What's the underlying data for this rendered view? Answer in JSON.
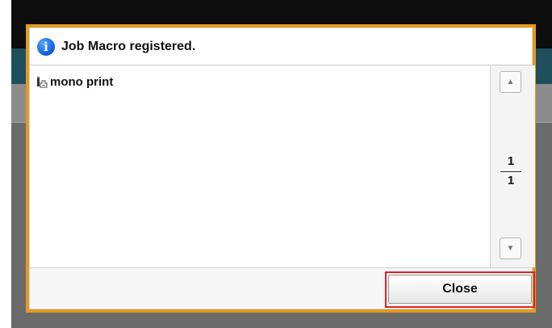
{
  "dialog": {
    "title": "Job Macro registered.",
    "title_icon": "info-icon",
    "items": [
      {
        "label": "mono print",
        "icon": "job-macro-icon"
      }
    ],
    "pager": {
      "current": "1",
      "total": "1"
    },
    "close_label": "Close"
  },
  "colors": {
    "dialog_border": "#e39a1f",
    "highlight": "#e02020",
    "info_icon": "#0a5ad8"
  }
}
